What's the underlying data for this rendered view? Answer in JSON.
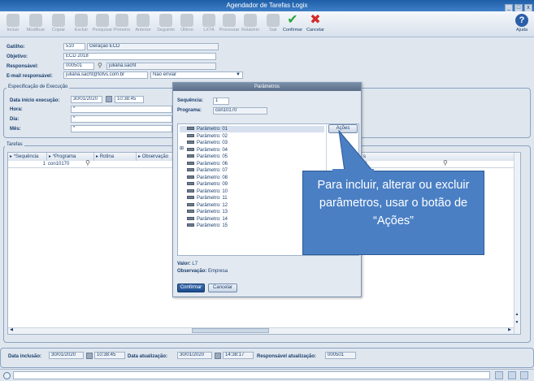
{
  "window": {
    "title": "Agendador de Tarefas Logix",
    "buttons": [
      "_",
      "□",
      "x"
    ]
  },
  "toolbar": {
    "items": [
      {
        "label": "Incluir",
        "icon": "add-icon",
        "enabled": false
      },
      {
        "label": "Modificar",
        "icon": "edit-icon",
        "enabled": false
      },
      {
        "label": "Copiar",
        "icon": "copy-icon",
        "enabled": false
      },
      {
        "label": "Excluir",
        "icon": "delete-icon",
        "enabled": false
      },
      {
        "label": "Pesquisar",
        "icon": "search-icon",
        "enabled": false
      },
      {
        "label": "Primeiro",
        "icon": "first-icon",
        "enabled": false
      },
      {
        "label": "Anterior",
        "icon": "previous-icon",
        "enabled": false
      },
      {
        "label": "Seguinte",
        "icon": "next-icon",
        "enabled": false
      },
      {
        "label": "Último",
        "icon": "last-icon",
        "enabled": false
      },
      {
        "label": "LXTA",
        "icon": "lxta-icon",
        "enabled": false
      },
      {
        "label": "Processar",
        "icon": "process-icon",
        "enabled": false
      },
      {
        "label": "Relatório",
        "icon": "report-icon",
        "enabled": false
      },
      {
        "label": "Sair",
        "icon": "exit-icon",
        "enabled": false
      },
      {
        "label": "Confirmar",
        "icon": "check-icon",
        "enabled": true
      },
      {
        "label": "Cancelar",
        "icon": "cancel-icon",
        "enabled": true
      }
    ],
    "help": "Ajuda"
  },
  "form": {
    "gatilho_label": "Gatilho:",
    "gatilho_code": "510",
    "gatilho_desc": "Geração ECD",
    "objetivo_label": "Objetivo:",
    "objetivo": "ECD 2018",
    "responsavel_label": "Responsável:",
    "responsavel_code": "000501",
    "responsavel_name": "juliana.sacht",
    "email_label": "E-mail responsável:",
    "email": "juliana.sacht@totvs.com.br",
    "email_option": "Não enviar"
  },
  "execucao": {
    "title": "Especificação de Execução",
    "data_label": "Data início execução:",
    "data": "30/01/2020",
    "hora_val": "10:38:45",
    "hora_label": "Hora:",
    "hora": "*",
    "dia_label": "Dia:",
    "dia": "*",
    "mes_label": "Mês:",
    "mes": "*"
  },
  "tarefas": {
    "title": "Tarefas",
    "columns": [
      "*Sequência",
      "*Programa",
      "Rotina",
      "Observação"
    ],
    "row": {
      "seq": "1",
      "programa": "con10170"
    },
    "hidden_col_frag": "s",
    "hidden_val_frag": "18"
  },
  "dialog": {
    "title": "Parâmetros",
    "seq_label": "Sequência:",
    "seq": "1",
    "prog_label": "Programa:",
    "prog": "con10170",
    "params": [
      "Parâmetro: 01",
      "Parâmetro: 02",
      "Parâmetro: 03",
      "Parâmetro: 04",
      "Parâmetro: 05",
      "Parâmetro: 06",
      "Parâmetro: 07",
      "Parâmetro: 08",
      "Parâmetro: 09",
      "Parâmetro: 10",
      "Parâmetro: 11",
      "Parâmetro: 12",
      "Parâmetro: 13",
      "Parâmetro: 14",
      "Parâmetro: 15"
    ],
    "acoes": "Ações",
    "valor_label": "Valor:",
    "valor": "L7",
    "obs_label": "Observação:",
    "obs": "Empresa",
    "confirm": "Confirmar",
    "cancel": "Cancelar"
  },
  "callout": {
    "text": "Para incluir, alterar ou excluir parâmetros, usar o botão de “Ações”"
  },
  "footer": {
    "inclusao_label": "Data inclusão:",
    "inclusao_data": "30/01/2020",
    "inclusao_hora": "10:38:45",
    "atualizacao_label": "Data atualização:",
    "atualizacao_data": "30/01/2020",
    "atualizacao_hora": "14:38:17",
    "resp_label": "Responsável atualização:",
    "resp": "000501"
  }
}
